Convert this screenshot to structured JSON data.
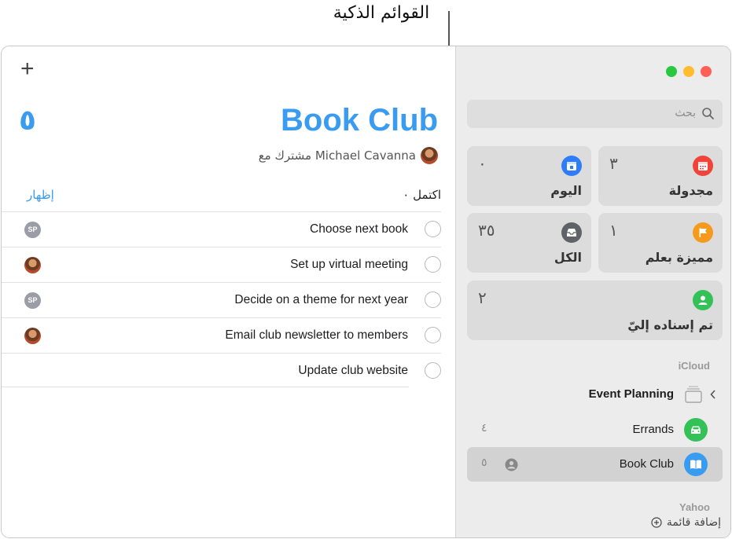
{
  "callout": {
    "label": "القوائم الذكية"
  },
  "main": {
    "add_symbol": "+",
    "title": "Book Club",
    "count": "٥",
    "shared_text": "مشترك مع Michael Cavanna",
    "completed_label": "اكتمل ٠",
    "show_label": "إظهار",
    "tasks": [
      {
        "text": "Choose next book",
        "assignee": "SP"
      },
      {
        "text": "Set up virtual meeting",
        "assignee": "photo"
      },
      {
        "text": "Decide on a theme for next year",
        "assignee": "SP"
      },
      {
        "text": "Email club newsletter to members",
        "assignee": "photo"
      },
      {
        "text": "Update club website",
        "assignee": ""
      }
    ]
  },
  "sidebar": {
    "search_placeholder": "بحث",
    "smart_lists": [
      {
        "label": "مجدولة",
        "count": "٣",
        "color": "#f0443a",
        "icon": "calendar-icon"
      },
      {
        "label": "اليوم",
        "count": "٠",
        "color": "#2f7df6",
        "icon": "today-calendar-icon"
      },
      {
        "label": "مميزة بعلم",
        "count": "١",
        "color": "#f59a1c",
        "icon": "flag-icon"
      },
      {
        "label": "الكل",
        "count": "٣٥",
        "color": "#5f6266",
        "icon": "tray-icon"
      },
      {
        "label": "تم إسناده إليّ",
        "count": "٢",
        "color": "#33c158",
        "icon": "person-icon"
      }
    ],
    "icloud_header": "iCloud",
    "group": {
      "label": "Event Planning"
    },
    "lists": [
      {
        "label": "Errands",
        "count": "٤",
        "color": "#33c158",
        "icon": "car-icon"
      },
      {
        "label": "Book Club",
        "count": "٥",
        "color": "#3a9cf0",
        "icon": "book-icon"
      }
    ],
    "yahoo_header": "Yahoo",
    "add_list_label": "إضافة قائمة"
  },
  "colors": {
    "accent": "#3a9cf0",
    "close": "#fe5f57",
    "minimize": "#febc2e",
    "zoom": "#28c840"
  }
}
